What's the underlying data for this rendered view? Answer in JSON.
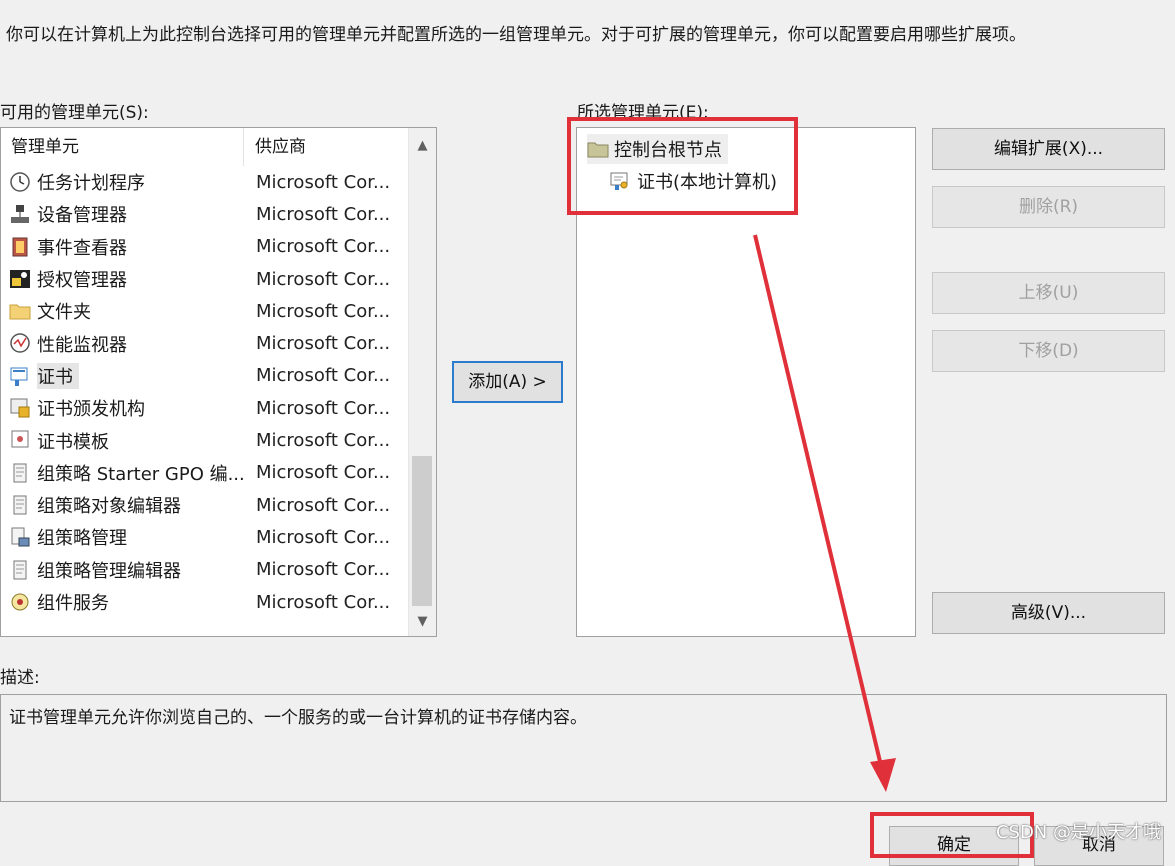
{
  "intro_text": "你可以在计算机上为此控制台选择可用的管理单元并配置所选的一组管理单元。对于可扩展的管理单元，你可以配置要启用哪些扩展项。",
  "available": {
    "label": "可用的管理单元(S):",
    "col_name": "管理单元",
    "col_vendor": "供应商",
    "items": [
      {
        "name": "任务计划程序",
        "vendor": "Microsoft Cor...",
        "icon": "clock-icon"
      },
      {
        "name": "设备管理器",
        "vendor": "Microsoft Cor...",
        "icon": "device-manager-icon"
      },
      {
        "name": "事件查看器",
        "vendor": "Microsoft Cor...",
        "icon": "event-viewer-icon"
      },
      {
        "name": "授权管理器",
        "vendor": "Microsoft Cor...",
        "icon": "authorization-icon"
      },
      {
        "name": "文件夹",
        "vendor": "Microsoft Cor...",
        "icon": "folder-icon"
      },
      {
        "name": "性能监视器",
        "vendor": "Microsoft Cor...",
        "icon": "performance-icon"
      },
      {
        "name": "证书",
        "vendor": "Microsoft Cor...",
        "icon": "certificate-icon"
      },
      {
        "name": "证书颁发机构",
        "vendor": "Microsoft Cor...",
        "icon": "cert-authority-icon"
      },
      {
        "name": "证书模板",
        "vendor": "Microsoft Cor...",
        "icon": "cert-template-icon"
      },
      {
        "name": "组策略 Starter GPO 编...",
        "vendor": "Microsoft Cor...",
        "icon": "policy-icon"
      },
      {
        "name": "组策略对象编辑器",
        "vendor": "Microsoft Cor...",
        "icon": "policy-icon"
      },
      {
        "name": "组策略管理",
        "vendor": "Microsoft Cor...",
        "icon": "policy-manage-icon"
      },
      {
        "name": "组策略管理编辑器",
        "vendor": "Microsoft Cor...",
        "icon": "policy-icon"
      },
      {
        "name": "组件服务",
        "vendor": "Microsoft Cor...",
        "icon": "component-services-icon"
      }
    ]
  },
  "add_button": "添加(A) >",
  "selected": {
    "label": "所选管理单元(E):",
    "root": "控制台根节点",
    "child": "证书(本地计算机)"
  },
  "buttons": {
    "edit_ext": "编辑扩展(X)...",
    "remove": "删除(R)",
    "move_up": "上移(U)",
    "move_down": "下移(D)",
    "advanced": "高级(V)...",
    "ok": "确定",
    "cancel": "取消"
  },
  "description": {
    "label": "描述:",
    "text": "证书管理单元允许你浏览自己的、一个服务的或一台计算机的证书存储内容。"
  },
  "watermark": "CSDN @是小天才哦",
  "colors": {
    "annotation": "#e0303a",
    "focus": "#2b7bcf"
  }
}
